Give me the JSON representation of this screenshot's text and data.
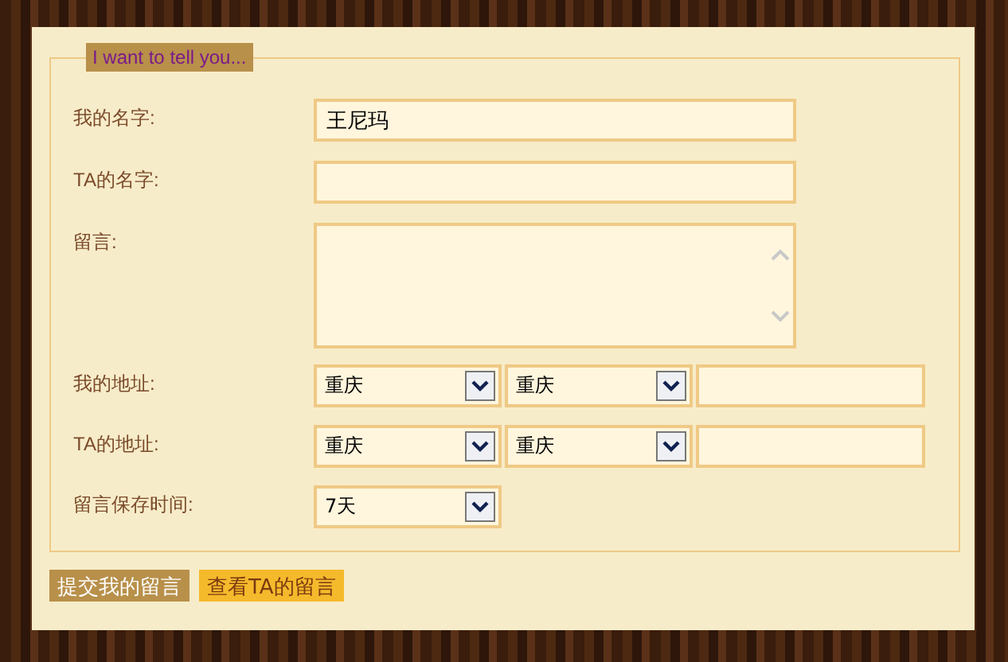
{
  "legend": "I want to tell you...",
  "fields": [
    {
      "kind": "text",
      "label": "我的名字:",
      "value": "王尼玛"
    },
    {
      "kind": "text",
      "label": "TA的名字:"
    },
    {
      "kind": "textarea",
      "label": "留言:"
    },
    {
      "kind": "address",
      "label": "我的地址:",
      "selects": [
        "重庆",
        "重庆"
      ]
    },
    {
      "kind": "address",
      "label": "TA的地址:",
      "selects": [
        "重庆",
        "重庆"
      ]
    },
    {
      "kind": "select",
      "label": "留言保存时间:",
      "selects": [
        "7天"
      ]
    }
  ],
  "buttons": [
    {
      "label": "提交我的留言",
      "kind": "primary"
    },
    {
      "label": "查看TA的留言",
      "kind": "secondary"
    }
  ]
}
